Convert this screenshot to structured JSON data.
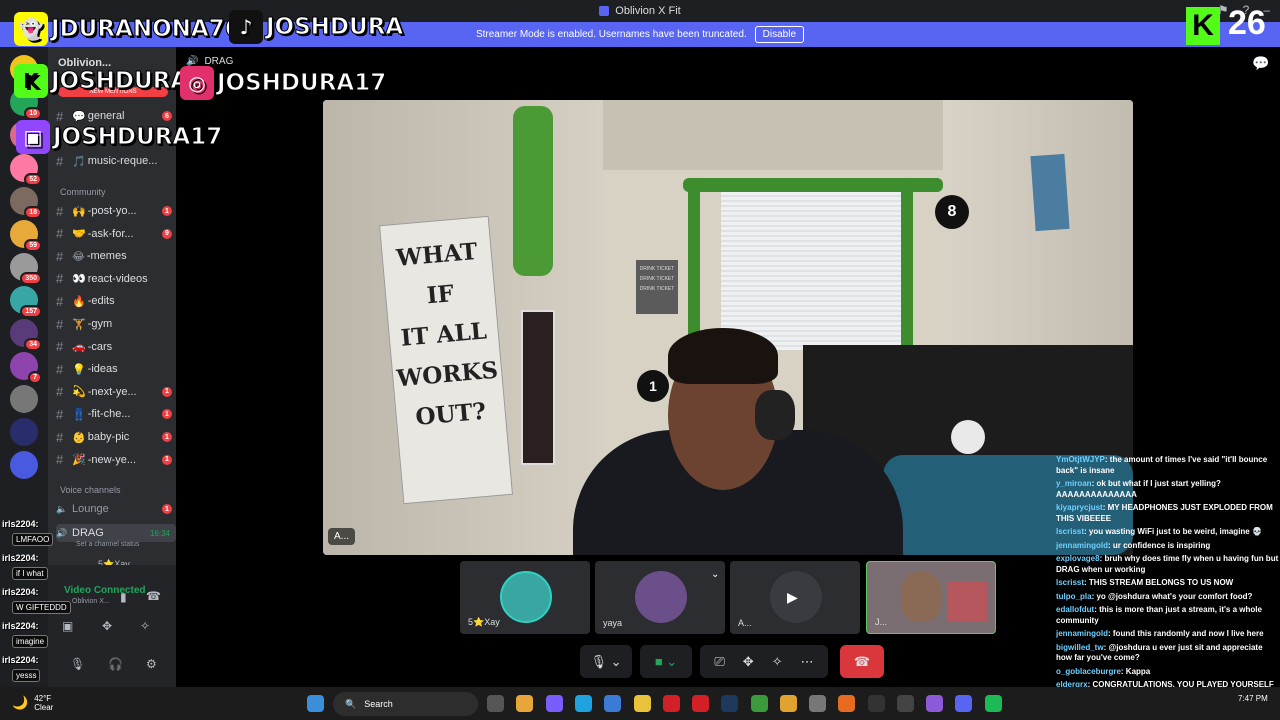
{
  "window": {
    "title": "Oblivion X Fit"
  },
  "banner": {
    "text": "Streamer Mode is enabled. Usernames have been truncated.",
    "disable_label": "Disable"
  },
  "overlay": {
    "snap_handle": "JDURANONA76",
    "tiktok_handle": "JOSHDURA",
    "kick_handle": "JOSHDURA",
    "instagram_handle": "JOSHDURA17",
    "twitch_handle": "JOSHDURA17",
    "kick_viewers": "26",
    "kick_letter": "K"
  },
  "server_rail": {
    "badges": [
      "10",
      "78",
      "52",
      "18",
      "59",
      "350",
      "157",
      "34",
      "7"
    ]
  },
  "sidebar": {
    "server_name": "Oblivion...",
    "new_mentions": "NEW MENTIONS",
    "channels_top": [
      {
        "label": "general",
        "emoji": "💬",
        "badge": "6"
      },
      {
        "label": "music-reque...",
        "emoji": "🎵",
        "badge": ""
      }
    ],
    "category_community": "Community",
    "channels_community": [
      {
        "label": "-post-yo...",
        "emoji": "🙌",
        "badge": "1"
      },
      {
        "label": "-ask-for...",
        "emoji": "🤝",
        "badge": "9"
      },
      {
        "label": "-memes",
        "emoji": "😂",
        "badge": ""
      },
      {
        "label": "react-videos",
        "emoji": "👀",
        "badge": ""
      },
      {
        "label": "-edits",
        "emoji": "🔥",
        "badge": ""
      },
      {
        "label": "-gym",
        "emoji": "🏋",
        "badge": ""
      },
      {
        "label": "-cars",
        "emoji": "🚗",
        "badge": ""
      },
      {
        "label": "-ideas",
        "emoji": "💡",
        "badge": ""
      },
      {
        "label": "-next-ye...",
        "emoji": "💫",
        "badge": "1"
      },
      {
        "label": "-fit-che...",
        "emoji": "👖",
        "badge": "1"
      },
      {
        "label": "baby-pic",
        "emoji": "👶",
        "badge": "1"
      },
      {
        "label": "-new-ye...",
        "emoji": "🎉",
        "badge": "1"
      }
    ],
    "category_voice": "Voice channels",
    "voice_lounge": "Lounge",
    "voice_lounge_badge": "1",
    "voice_drag": "DRAG",
    "voice_drag_time": "16:34",
    "voice_drag_status": "Set a channel status",
    "voice_user": "5⭐Xay"
  },
  "voice_panel": {
    "connected": "Video Connected",
    "server": "Oblivion X..."
  },
  "stage": {
    "channel_label": "DRAG",
    "video_name": "A...",
    "tiles": [
      {
        "name": "5⭐Xay"
      },
      {
        "name": "yaya"
      },
      {
        "name": "A..."
      },
      {
        "name": "J..."
      }
    ]
  },
  "left_chat_overlay": [
    {
      "user": "irls2204:",
      "msg": "LMFAOO"
    },
    {
      "user": "irls2204:",
      "msg": "if I what"
    },
    {
      "user": "irls2204:",
      "msg": "W GIFTEDDD"
    },
    {
      "user": "irls2204:",
      "msg": "imagine"
    },
    {
      "user": "irls2204:",
      "msg": "yesss"
    }
  ],
  "chat": [
    {
      "user": "YmOtjtWJYP",
      "color": "#6fd0ff",
      "msg": ": the amount of times I've said \"it'll bounce back\" is insane"
    },
    {
      "user": "y_miroan",
      "color": "#6fd0ff",
      "msg": ": ok but what if I just start yelling? AAAAAAAAAAAAAA"
    },
    {
      "user": "kiyaprycjust",
      "color": "#6fd0ff",
      "msg": ": MY HEADPHONES JUST EXPLODED FROM THIS VIBEEEE"
    },
    {
      "user": "lscrisst",
      "color": "#6fd0ff",
      "msg": ": you wasting WiFi just to be weird, imagine 💀"
    },
    {
      "user": "jennamingold",
      "color": "#6fd0ff",
      "msg": ": ur confidence is inspiring"
    },
    {
      "user": "explovage8",
      "color": "#6fd0ff",
      "msg": ": bruh why does time fly when u having fun but DRAG when ur working"
    },
    {
      "user": "lscrisst",
      "color": "#6fd0ff",
      "msg": ": THIS STREAM BELONGS TO US NOW"
    },
    {
      "user": "tulpo_pla",
      "color": "#6fd0ff",
      "msg": ": yo @joshdura what's your comfort food?"
    },
    {
      "user": "edallofdut",
      "color": "#6fd0ff",
      "msg": ": this is more than just a stream, it's a whole community"
    },
    {
      "user": "jennamingold",
      "color": "#6fd0ff",
      "msg": ": found this randomly and now I live here"
    },
    {
      "user": "bigwilled_tw",
      "color": "#6fd0ff",
      "msg": ": @joshdura u ever just sit and appreciate how far you've come?"
    },
    {
      "user": "o_goblaceburgre",
      "color": "#6fd0ff",
      "msg": ": Kappa"
    },
    {
      "user": "eldergrx",
      "color": "#6fd0ff",
      "msg": ": CONGRATULATIONS, YOU PLAYED YOURSELF"
    }
  ],
  "taskbar": {
    "temp": "42°F",
    "weather": "Clear",
    "search": "Search",
    "time": "7:47 PM"
  },
  "colors": {
    "blurple": "#5865f2",
    "danger": "#da373c",
    "kick_green": "#53fc18"
  }
}
